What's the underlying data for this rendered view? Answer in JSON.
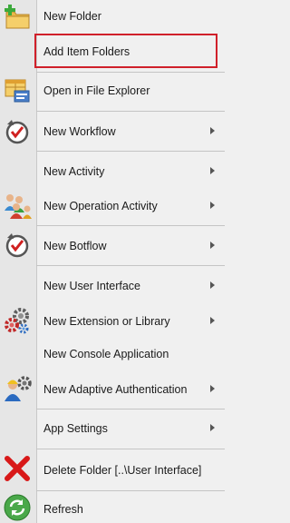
{
  "menu": {
    "items": [
      {
        "label": "New Folder",
        "icon": "new-folder-icon",
        "submenu": false
      },
      {
        "label": "Add Item Folders",
        "icon": "",
        "submenu": false,
        "highlighted": true
      },
      {
        "label": "Open in File Explorer",
        "icon": "file-explorer-icon",
        "submenu": false
      },
      {
        "label": "New Workflow",
        "icon": "workflow-icon",
        "submenu": true
      },
      {
        "label": "New Activity",
        "icon": "",
        "submenu": true
      },
      {
        "label": "New Operation Activity",
        "icon": "operation-activity-icon",
        "submenu": true
      },
      {
        "label": "New Botflow",
        "icon": "botflow-icon",
        "submenu": true
      },
      {
        "label": "New User Interface",
        "icon": "",
        "submenu": true
      },
      {
        "label": "New Extension or Library",
        "icon": "extension-library-icon",
        "submenu": true
      },
      {
        "label": "New Console Application",
        "icon": "",
        "submenu": false
      },
      {
        "label": "New Adaptive Authentication",
        "icon": "adaptive-authentication-icon",
        "submenu": true
      },
      {
        "label": "App Settings",
        "icon": "",
        "submenu": true
      },
      {
        "label": "Delete Folder [..\\User Interface]",
        "icon": "delete-icon",
        "submenu": false
      },
      {
        "label": "Refresh",
        "icon": "refresh-icon",
        "submenu": false
      }
    ],
    "highlight_color": "#d0202a"
  }
}
